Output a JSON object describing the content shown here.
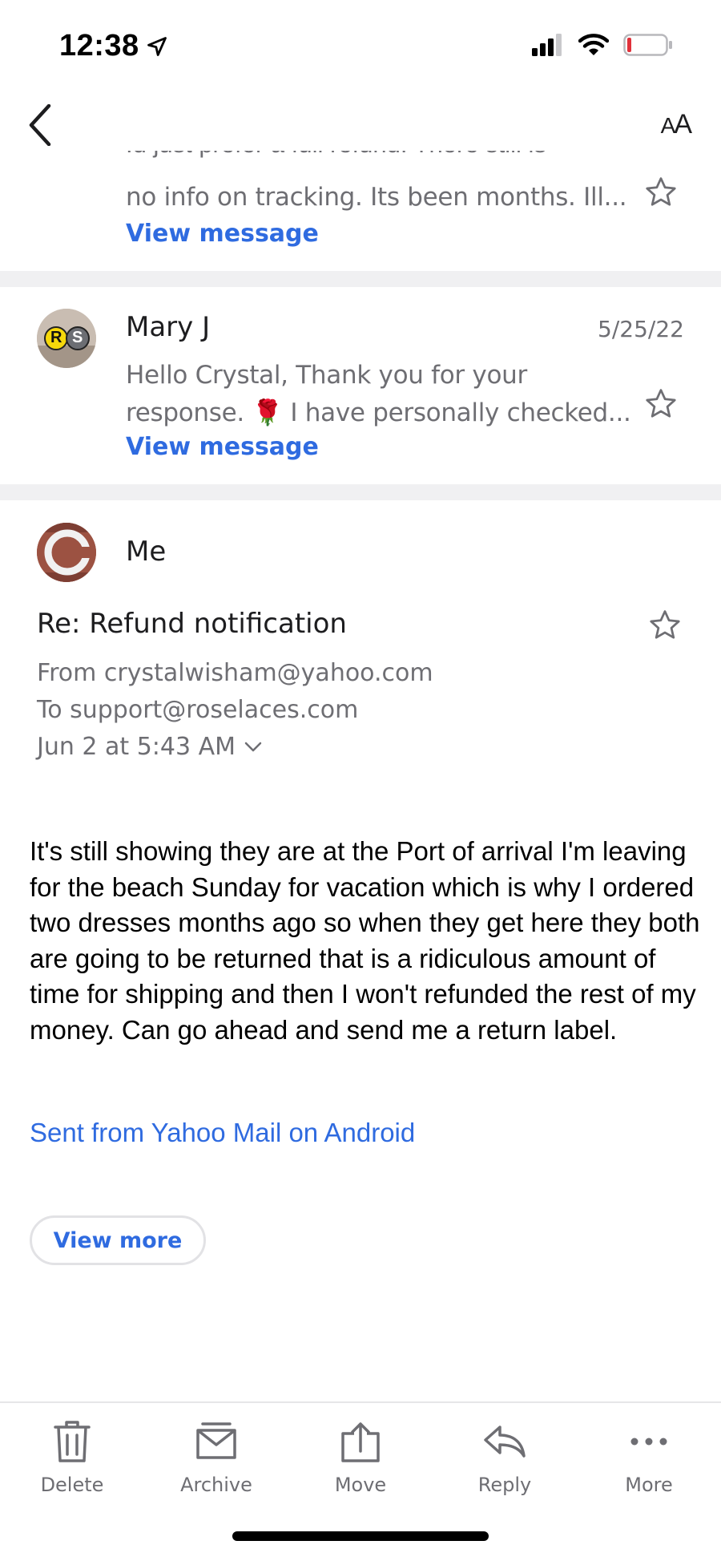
{
  "status_bar": {
    "time": "12:38"
  },
  "nav": {
    "font_small": "A",
    "font_large": "A"
  },
  "thread": {
    "top_message": {
      "clipped_line": "Id just prefer a full refund. There still is",
      "preview": "no info on tracking. Its been months. Ill...",
      "link": "View message"
    },
    "mary_message": {
      "sender": "Mary J",
      "date": "5/25/22",
      "avatar_letters": [
        "R",
        "S"
      ],
      "preview_line1": "Hello Crystal, Thank you for your",
      "preview_line2_pre": "response.",
      "preview_line2_emoji": "🌹",
      "preview_line2_post": "I have personally checked...",
      "link": "View message"
    },
    "open_message": {
      "sender": "Me",
      "avatar_letter": "C",
      "subject": "Re: Refund notification",
      "from": "From crystalwisham@yahoo.com",
      "to": "To support@roselaces.com",
      "date": "Jun 2 at 5:43 AM",
      "body": "It's still showing they are at the Port of arrival I'm leaving for the beach Sunday for vacation which is why I ordered two dresses months ago so when they get here they both are going to be returned that is a ridiculous amount of time for shipping and then I won't refunded the rest of my money. Can go ahead and send me a return label.",
      "signature": "Sent from Yahoo Mail on Android",
      "view_more": "View more"
    }
  },
  "toolbar": {
    "delete": "Delete",
    "archive": "Archive",
    "move": "Move",
    "reply": "Reply",
    "more": "More"
  },
  "colors": {
    "accent": "#2f6be0",
    "secondary_text": "#6e6e73",
    "divider": "#f0f0f2",
    "battery_low": "#e0313a"
  }
}
